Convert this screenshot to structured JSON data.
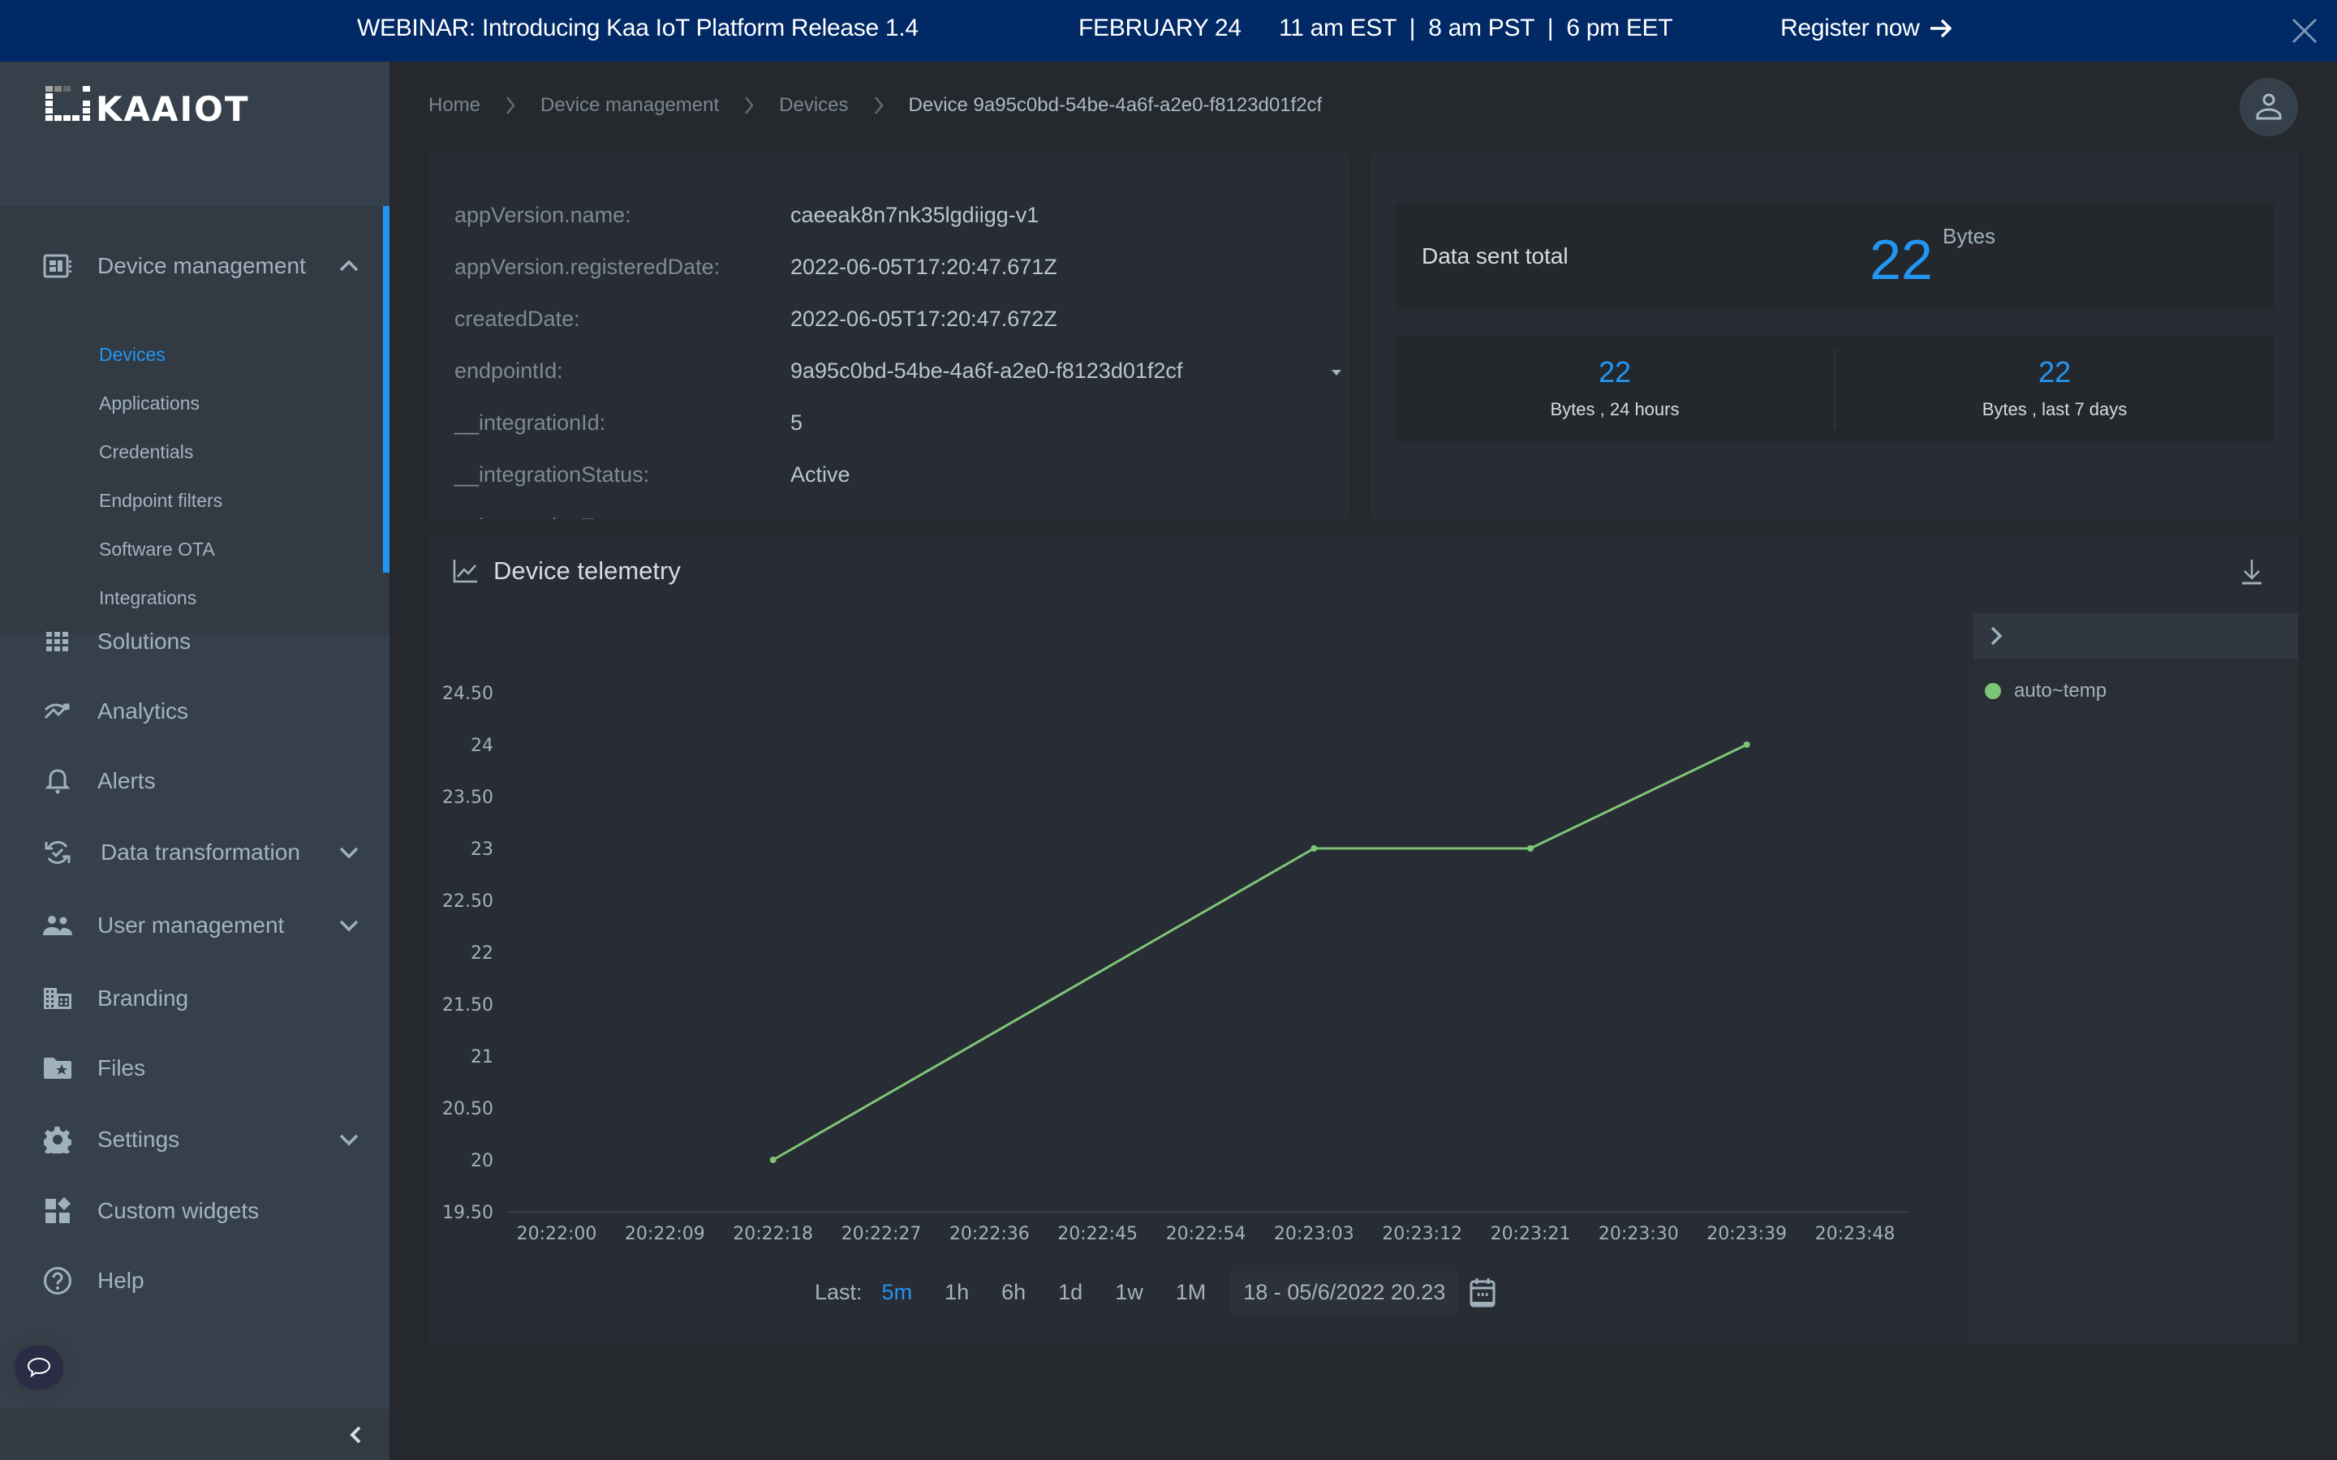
{
  "banner": {
    "title": "WEBINAR: Introducing Kaa IoT Platform Release 1.4",
    "date": "FEBRUARY 24",
    "times": "11 am EST  |  8 am PST  |  6 pm EET",
    "register_label": "Register now",
    "bg_color": "#002966"
  },
  "brand": {
    "logo_text": "KAAIOT"
  },
  "sidebar": {
    "items": [
      {
        "label": "Device management",
        "icon": "devices-icon",
        "expanded": true,
        "children": [
          {
            "label": "Devices",
            "active": true
          },
          {
            "label": "Applications"
          },
          {
            "label": "Credentials"
          },
          {
            "label": "Endpoint filters"
          },
          {
            "label": "Software OTA"
          },
          {
            "label": "Integrations"
          }
        ]
      },
      {
        "label": "Solutions",
        "icon": "grid-icon"
      },
      {
        "label": "Analytics",
        "icon": "analytics-icon"
      },
      {
        "label": "Alerts",
        "icon": "bell-icon"
      },
      {
        "label": "Data transformation",
        "icon": "sync-check-icon",
        "expandable": true
      },
      {
        "label": "User management",
        "icon": "users-icon",
        "expandable": true
      },
      {
        "label": "Branding",
        "icon": "building-icon"
      },
      {
        "label": "Files",
        "icon": "folder-star-icon"
      },
      {
        "label": "Settings",
        "icon": "gear-icon",
        "expandable": true
      },
      {
        "label": "Custom widgets",
        "icon": "widgets-icon"
      },
      {
        "label": "Help",
        "icon": "help-icon"
      }
    ],
    "accent_color": "#2196f3"
  },
  "breadcrumb": [
    "Home",
    "Device management",
    "Devices",
    "Device 9a95c0bd-54be-4a6f-a2e0-f8123d01f2cf"
  ],
  "device_info": [
    {
      "key": "appVersion.name:",
      "value": "caeeak8n7nk35lgdiigg-v1"
    },
    {
      "key": "appVersion.registeredDate:",
      "value": "2022-06-05T17:20:47.671Z"
    },
    {
      "key": "createdDate:",
      "value": "2022-06-05T17:20:47.672Z"
    },
    {
      "key": "endpointId:",
      "value": "9a95c0bd-54be-4a6f-a2e0-f8123d01f2cf",
      "dropdown": true
    },
    {
      "key": "__integrationId:",
      "value": "5"
    },
    {
      "key": "__integrationStatus:",
      "value": "Active"
    },
    {
      "key": "__integrationType:",
      "value": ""
    }
  ],
  "stats": {
    "total_label": "Data sent total",
    "total_value": "22",
    "total_unit": "Bytes",
    "day_value": "22",
    "day_label": "Bytes , 24 hours",
    "week_value": "22",
    "week_label": "Bytes , last 7 days"
  },
  "telemetry": {
    "title": "Device telemetry",
    "time_label": "Last:",
    "time_options": [
      "5m",
      "1h",
      "6h",
      "1d",
      "1w",
      "1M"
    ],
    "time_selected": "5m",
    "range_text": "18 - 05/6/2022 20.23"
  },
  "chart_data": {
    "type": "line",
    "title": "Device telemetry",
    "xlabel": "",
    "ylabel": "",
    "x_ticks": [
      "20:22:00",
      "20:22:09",
      "20:22:18",
      "20:22:27",
      "20:22:36",
      "20:22:45",
      "20:22:54",
      "20:23:03",
      "20:23:12",
      "20:23:21",
      "20:23:30",
      "20:23:39",
      "20:23:48"
    ],
    "y_ticks": [
      "19.50",
      "20",
      "20.50",
      "21",
      "21.50",
      "22",
      "22.50",
      "23",
      "23.50",
      "24",
      "24.50"
    ],
    "ylim": [
      19.5,
      24.5
    ],
    "xlim": [
      "20:22:00",
      "20:23:48"
    ],
    "grid": false,
    "legend": "right-panel",
    "series": [
      {
        "name": "auto~temp",
        "color": "#7dc576",
        "x": [
          "20:22:18",
          "20:23:03",
          "20:23:21",
          "20:23:39"
        ],
        "values": [
          20,
          23,
          23,
          24
        ]
      }
    ]
  }
}
